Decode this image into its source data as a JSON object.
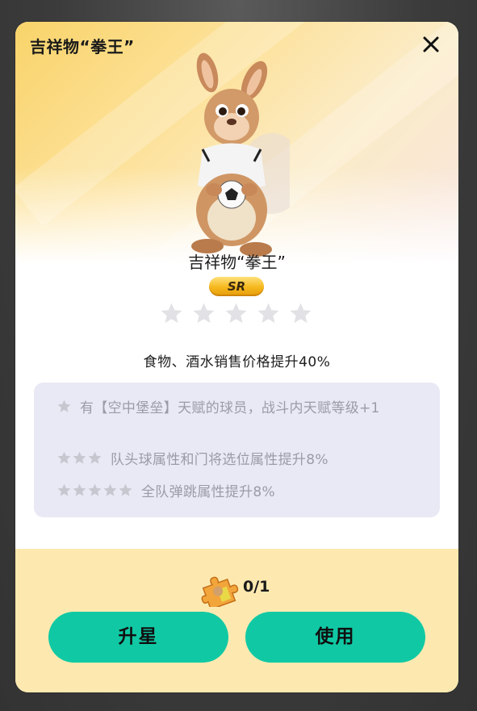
{
  "modal": {
    "title": "吉祥物“拳王”",
    "close_icon": "close-icon"
  },
  "item": {
    "name": "吉祥物“拳王”",
    "rarity": "SR",
    "stars_filled": 0,
    "stars_total": 5,
    "effect": "食物、酒水销售价格提升40%"
  },
  "star_bonuses": [
    {
      "stars": 1,
      "text": "有【空中堡垒】天赋的球员，战斗内天赋等级+1"
    },
    {
      "stars": 3,
      "text": "队头球属性和门将选位属性提升8%"
    },
    {
      "stars": 5,
      "text": "全队弹跳属性提升8%"
    }
  ],
  "footer": {
    "fragment_icon": "puzzle-piece-icon",
    "fragment_count": "0/1",
    "upgrade_label": "升星",
    "use_label": "使用"
  },
  "colors": {
    "accent": "#10c9a4",
    "footer_bg": "#fde9b0",
    "panel_bg": "#e9e9f5",
    "star_empty": "#e2e2e6"
  }
}
